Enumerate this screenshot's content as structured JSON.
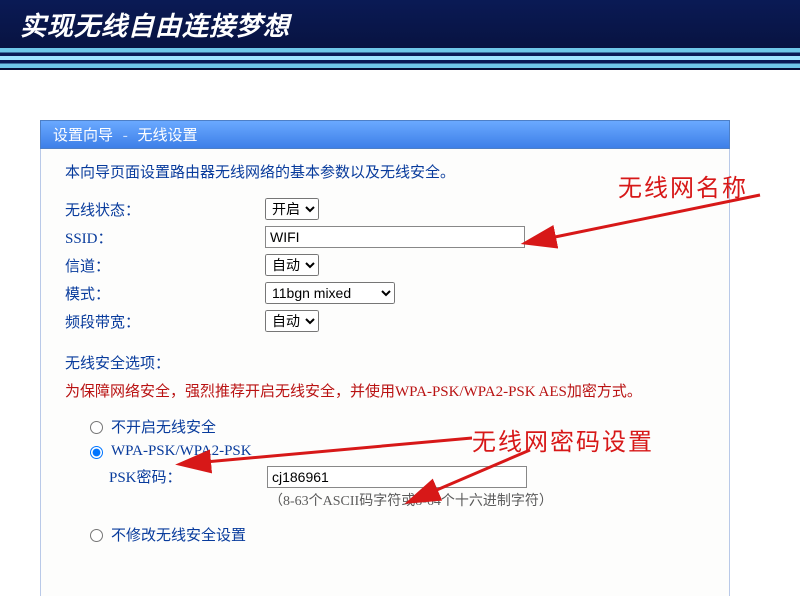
{
  "banner": {
    "slogan": "实现无线自由连接梦想"
  },
  "panel": {
    "title_a": "设置向导",
    "title_sep": "-",
    "title_b": "无线设置",
    "intro": "本向导页面设置路由器无线网络的基本参数以及无线安全。"
  },
  "fields": {
    "wireless_state": {
      "label": "无线状态：",
      "value": "开启"
    },
    "ssid": {
      "label": "SSID：",
      "value": "WIFI"
    },
    "channel": {
      "label": "信道：",
      "value": "自动"
    },
    "mode": {
      "label": "模式：",
      "value": "11bgn mixed"
    },
    "bandwidth": {
      "label": "频段带宽：",
      "value": "自动"
    }
  },
  "security": {
    "heading": "无线安全选项：",
    "note": "为保障网络安全，强烈推荐开启无线安全，并使用WPA-PSK/WPA2-PSK AES加密方式。",
    "opt_off": "不开启无线安全",
    "opt_wpa": "WPA-PSK/WPA2-PSK",
    "opt_keep": "不修改无线安全设置",
    "psk_label": "PSK密码：",
    "psk_value": "cj186961",
    "psk_hint": "（8-63个ASCII码字符或8-64个十六进制字符）"
  },
  "annotations": {
    "ssid_label": "无线网名称",
    "pwd_label": "无线网密码设置"
  }
}
